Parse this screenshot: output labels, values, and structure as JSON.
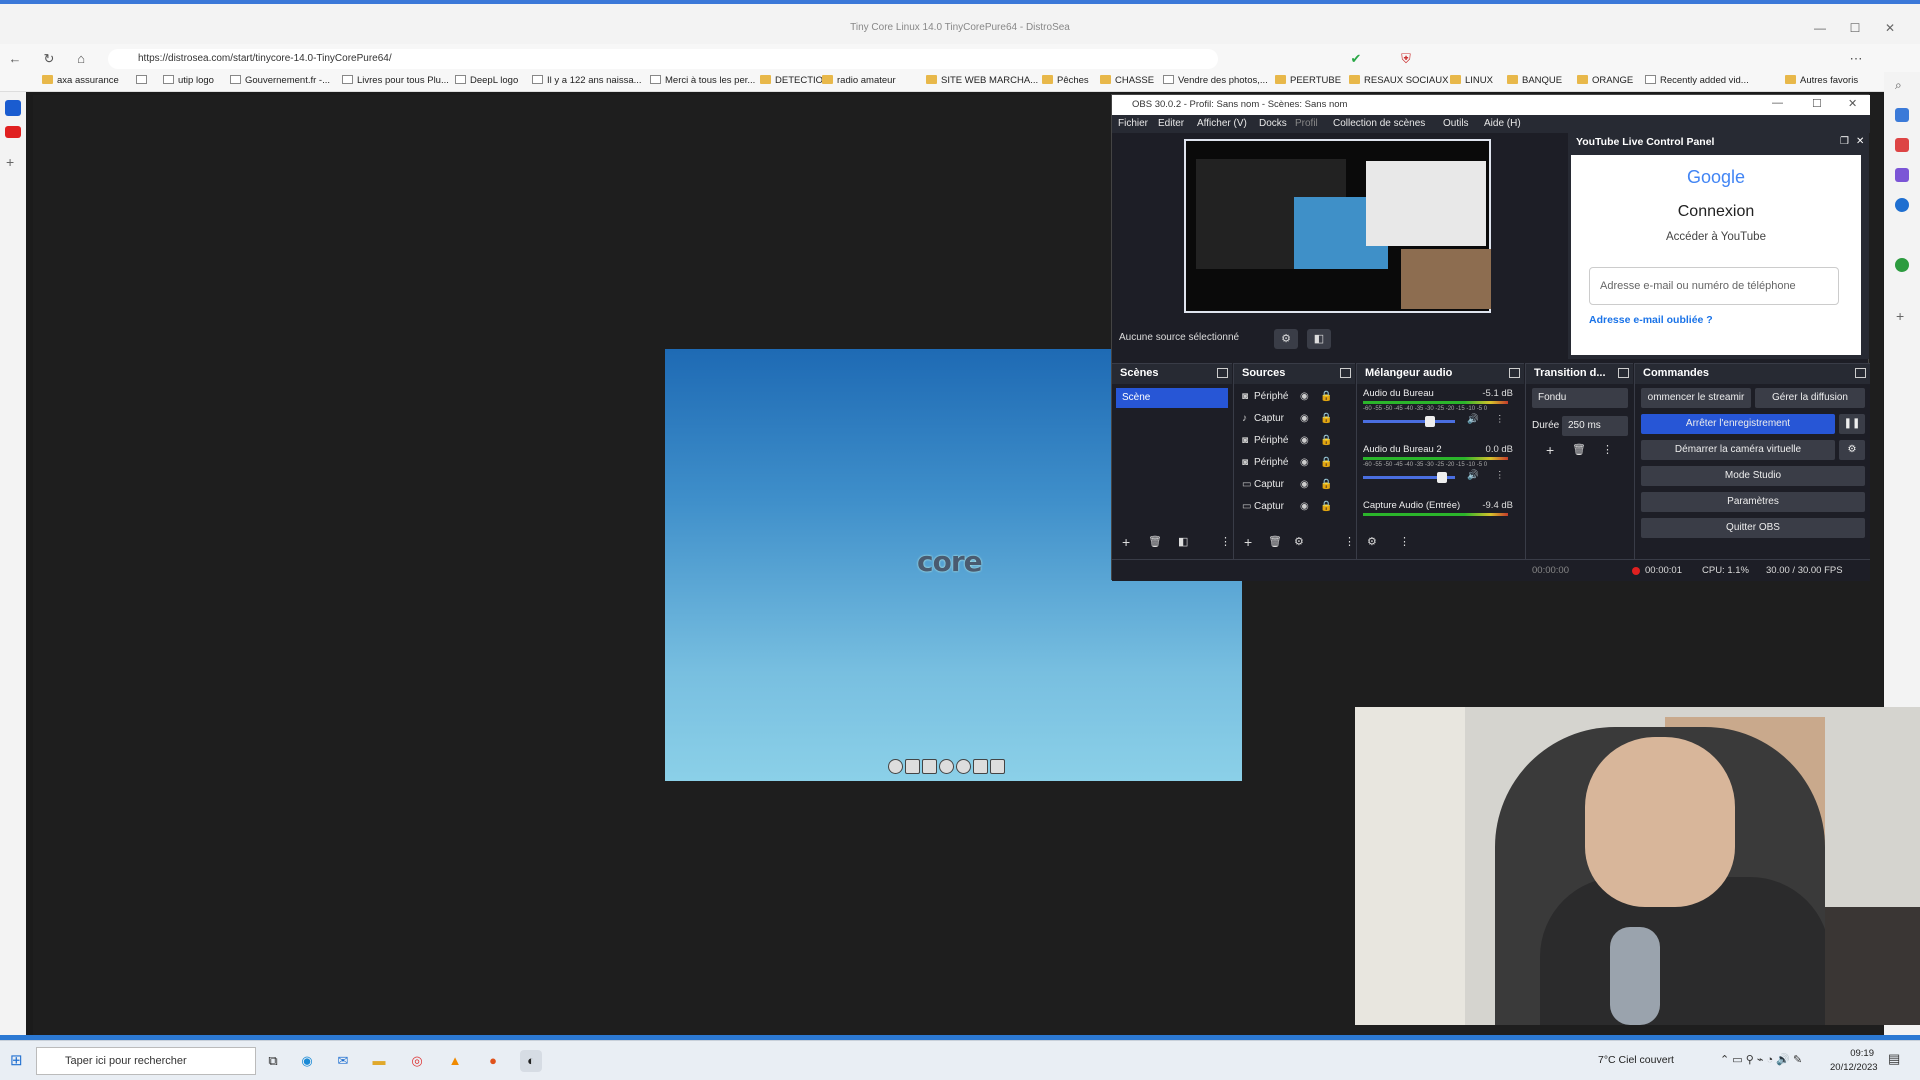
{
  "browser": {
    "window_title": "Tiny Core Linux 14.0 TinyCorePure64 - DistroSea",
    "url": "https://distrosea.com/start/tinycore-14.0-TinyCorePure64/",
    "bookmarks": [
      {
        "label": "axa assurance",
        "type": "folder"
      },
      {
        "label": "",
        "type": "page"
      },
      {
        "label": "utip logo",
        "type": "page"
      },
      {
        "label": "Gouvernement.fr -...",
        "type": "page"
      },
      {
        "label": "Livres pour tous Plu...",
        "type": "page"
      },
      {
        "label": "DeepL logo",
        "type": "page"
      },
      {
        "label": "Il y a 122 ans naissa...",
        "type": "page"
      },
      {
        "label": "Merci à tous les per...",
        "type": "page"
      },
      {
        "label": "DETECTION",
        "type": "folder"
      },
      {
        "label": "radio amateur",
        "type": "folder"
      },
      {
        "label": "SITE WEB MARCHA...",
        "type": "folder"
      },
      {
        "label": "Pêches",
        "type": "folder"
      },
      {
        "label": "CHASSE",
        "type": "folder"
      },
      {
        "label": "Vendre des photos,...",
        "type": "page"
      },
      {
        "label": "PEERTUBE",
        "type": "folder"
      },
      {
        "label": "RESAUX SOCIAUX",
        "type": "folder"
      },
      {
        "label": "LINUX",
        "type": "folder"
      },
      {
        "label": "BANQUE",
        "type": "folder"
      },
      {
        "label": "ORANGE",
        "type": "folder"
      },
      {
        "label": "Recently added vid...",
        "type": "page"
      },
      {
        "label": "Autres favoris",
        "type": "folder"
      }
    ]
  },
  "desktop": {
    "logo_text": "core"
  },
  "obs": {
    "title": "OBS 30.0.2 - Profil: Sans nom - Scènes: Sans nom",
    "menu": [
      "Fichier",
      "Editer",
      "Afficher (V)",
      "Docks",
      "Profil",
      "Collection de scènes",
      "Outils",
      "Aide (H)"
    ],
    "no_source": "Aucune source sélectionné",
    "youtube": {
      "title": "YouTube Live Control Panel",
      "google": "Google",
      "connexion": "Connexion",
      "subtitle": "Accéder à YouTube",
      "email_placeholder": "Adresse e-mail ou numéro de téléphone",
      "forgot": "Adresse e-mail oubliée ?"
    },
    "scenes": {
      "title": "Scènes",
      "items": [
        "Scène"
      ]
    },
    "sources": {
      "title": "Sources",
      "items": [
        "Périphé",
        "Captur",
        "Périphé",
        "Périphé",
        "Captur",
        "Captur"
      ]
    },
    "mixer": {
      "title": "Mélangeur audio",
      "scale": "-60 -55 -50 -45 -40 -35 -30 -25 -20 -15 -10 -5 0",
      "channels": [
        {
          "name": "Audio du Bureau",
          "db": "-5.1 dB",
          "level": 0.75
        },
        {
          "name": "Audio du Bureau 2",
          "db": "0.0 dB",
          "level": 0.9
        },
        {
          "name": "Capture Audio (Entrée)",
          "db": "-9.4 dB",
          "level": 0.7
        }
      ]
    },
    "transition": {
      "title": "Transition d...",
      "type": "Fondu",
      "duration_label": "Durée",
      "duration": "250 ms"
    },
    "commands": {
      "title": "Commandes",
      "start_stream": "ommencer le streamir",
      "manage": "Gérer la diffusion",
      "stop_record": "Arrêter l'enregistrement",
      "virtual_cam": "Démarrer la caméra virtuelle",
      "studio": "Mode Studio",
      "settings": "Paramètres",
      "quit": "Quitter OBS"
    },
    "status": {
      "stream_time": "00:00:00",
      "rec_time": "00:00:01",
      "cpu": "CPU: 1.1%",
      "fps": "30.00 / 30.00 FPS"
    },
    "colors": {
      "accent": "#2756d6",
      "rec": "#e02020"
    }
  },
  "taskbar": {
    "search_placeholder": "Taper ici pour rechercher",
    "weather": "7°C  Ciel couvert",
    "time": "09:19",
    "date": "20/12/2023"
  }
}
